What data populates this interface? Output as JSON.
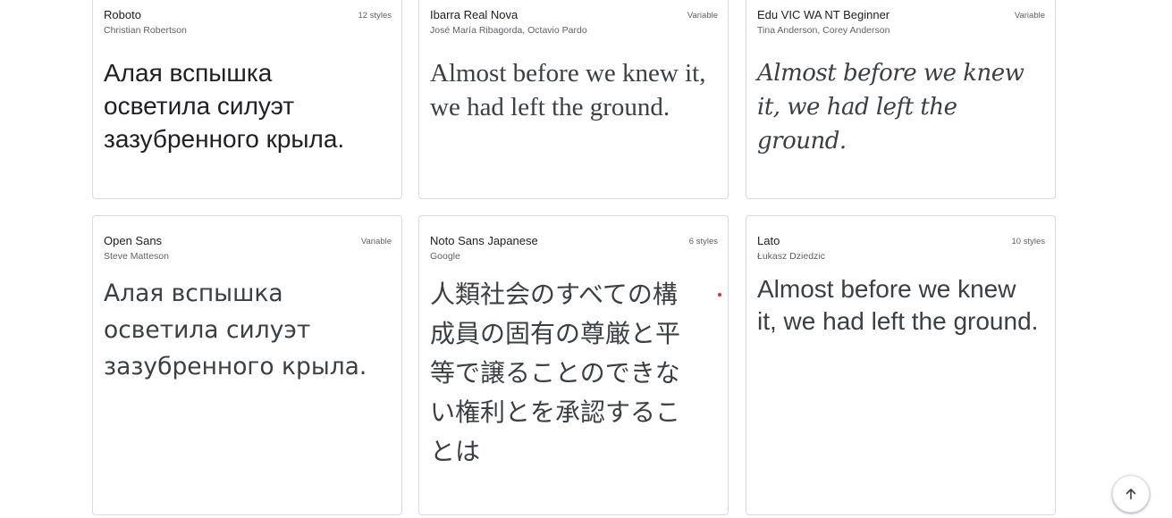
{
  "cards": [
    {
      "name": "Roboto",
      "styles": "12 styles",
      "designer": "Christian Robertson",
      "sample": "Алая вспышка осветила силуэт зазубренного крыла."
    },
    {
      "name": "Ibarra Real Nova",
      "styles": "Variable",
      "designer": "José María Ribagorda, Octavio Pardo",
      "sample": "Almost before we knew it, we had left the ground."
    },
    {
      "name": "Edu VIC WA NT Beginner",
      "styles": "Variable",
      "designer": "Tina Anderson, Corey Anderson",
      "sample": "Almost before we knew it, we had left the ground."
    },
    {
      "name": "Open Sans",
      "styles": "Variable",
      "designer": "Steve Matteson",
      "sample": "Алая вспышка осветила силуэт зазубренного крыла."
    },
    {
      "name": "Noto Sans Japanese",
      "styles": "6 styles",
      "designer": "Google",
      "sample": "人類社会のすべての構成員の固有の尊厳と平等で譲ることのできない権利とを承認することは"
    },
    {
      "name": "Lato",
      "styles": "10 styles",
      "designer": "Łukasz Dziedzic",
      "sample": "Almost before we knew it, we had left the ground."
    }
  ],
  "scroll_top": {
    "icon": "arrow-up-icon"
  },
  "colors": {
    "card_border": "#dadce0",
    "text_primary": "#202124",
    "text_secondary": "#5f6368",
    "indicator_dot": "#d93025"
  }
}
